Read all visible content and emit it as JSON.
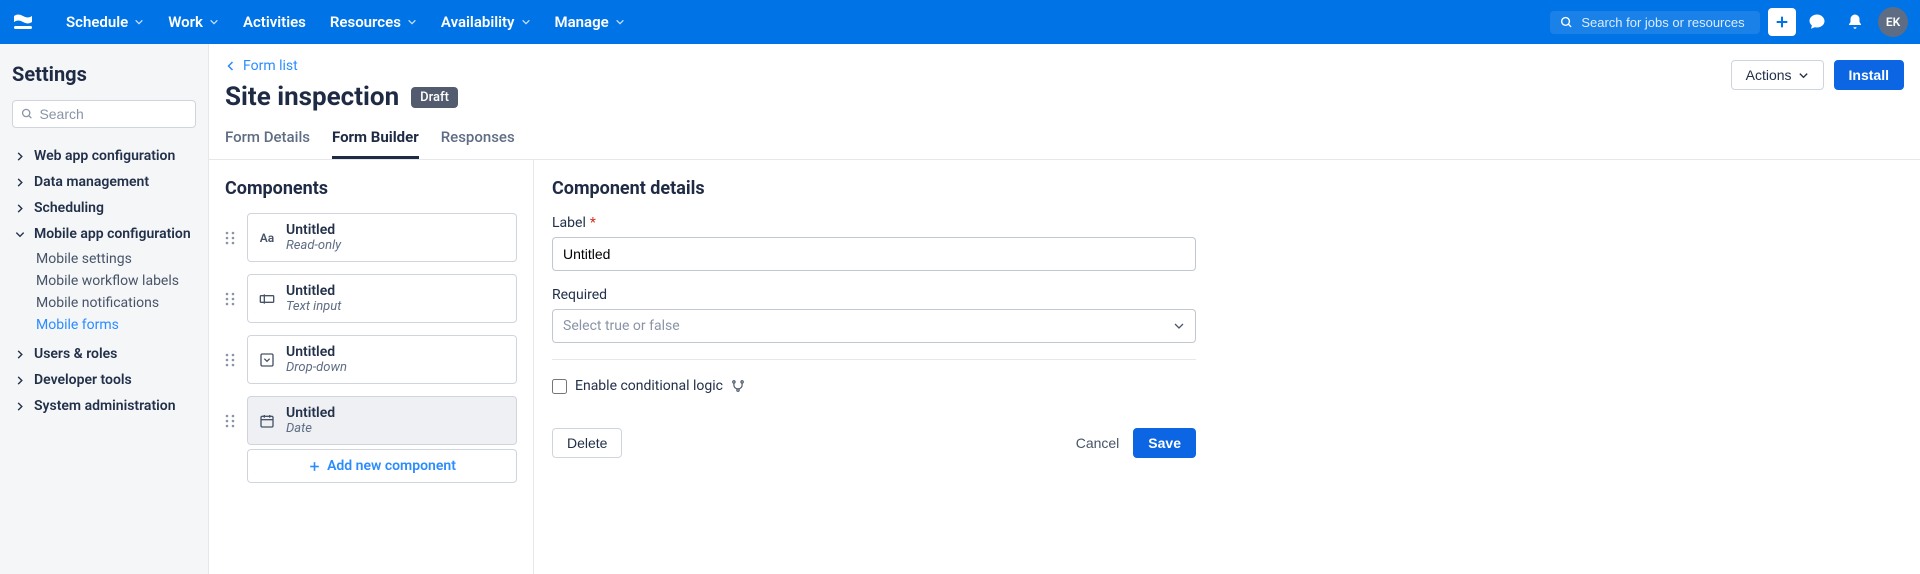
{
  "topnav": {
    "items": [
      {
        "label": "Schedule",
        "dropdown": true
      },
      {
        "label": "Work",
        "dropdown": true
      },
      {
        "label": "Activities",
        "dropdown": false
      },
      {
        "label": "Resources",
        "dropdown": true
      },
      {
        "label": "Availability",
        "dropdown": true
      },
      {
        "label": "Manage",
        "dropdown": true
      }
    ],
    "search_placeholder": "Search for jobs or resources",
    "avatar_initials": "EK"
  },
  "sidebar": {
    "title": "Settings",
    "search_placeholder": "Search",
    "groups": [
      {
        "label": "Web app configuration",
        "expanded": false,
        "items": []
      },
      {
        "label": "Data management",
        "expanded": false,
        "items": []
      },
      {
        "label": "Scheduling",
        "expanded": false,
        "items": []
      },
      {
        "label": "Mobile app configuration",
        "expanded": true,
        "items": [
          {
            "label": "Mobile settings",
            "active": false
          },
          {
            "label": "Mobile workflow labels",
            "active": false
          },
          {
            "label": "Mobile notifications",
            "active": false
          },
          {
            "label": "Mobile forms",
            "active": true
          }
        ]
      },
      {
        "label": "Users & roles",
        "expanded": false,
        "items": []
      },
      {
        "label": "Developer tools",
        "expanded": false,
        "items": []
      },
      {
        "label": "System administration",
        "expanded": false,
        "items": []
      }
    ]
  },
  "page": {
    "breadcrumb_label": "Form list",
    "title": "Site inspection",
    "status_badge": "Draft",
    "actions_button": "Actions",
    "install_button": "Install",
    "tabs": [
      {
        "label": "Form Details",
        "active": false
      },
      {
        "label": "Form Builder",
        "active": true
      },
      {
        "label": "Responses",
        "active": false
      }
    ]
  },
  "components": {
    "heading": "Components",
    "add_label": "Add new component",
    "items": [
      {
        "title": "Untitled",
        "subtitle": "Read-only",
        "icon": "text",
        "selected": false
      },
      {
        "title": "Untitled",
        "subtitle": "Text input",
        "icon": "input",
        "selected": false
      },
      {
        "title": "Untitled",
        "subtitle": "Drop-down",
        "icon": "dropdown",
        "selected": false
      },
      {
        "title": "Untitled",
        "subtitle": "Date",
        "icon": "date",
        "selected": true
      }
    ]
  },
  "details": {
    "heading": "Component details",
    "label_field": "Label",
    "label_value": "Untitled",
    "required_field": "Required",
    "required_placeholder": "Select true or false",
    "conditional_label": "Enable conditional logic",
    "delete_button": "Delete",
    "cancel_button": "Cancel",
    "save_button": "Save"
  }
}
